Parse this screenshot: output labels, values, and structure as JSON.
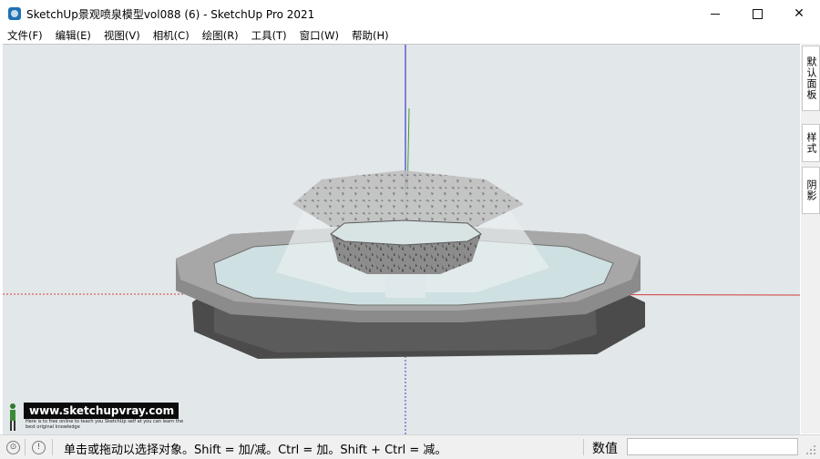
{
  "window": {
    "title": "SketchUp景观喷泉模型vol088 (6) - SketchUp Pro 2021",
    "minimize": "",
    "maximize": "",
    "close": "✕"
  },
  "menu": {
    "items": [
      "文件(F)",
      "编辑(E)",
      "视图(V)",
      "相机(C)",
      "绘图(R)",
      "工具(T)",
      "窗口(W)",
      "帮助(H)"
    ]
  },
  "tray": {
    "tabs": [
      "默认面板",
      "样式",
      "阴影"
    ]
  },
  "watermark": {
    "banner": "www.sketchupvray.com",
    "subtext": "Here is to free online to teach you SketchUp self at you can learn the best original knowledge"
  },
  "status": {
    "message": "单击或拖动以选择对象。Shift = 加/减。Ctrl = 加。Shift + Ctrl = 减。",
    "measurements_label": "数值",
    "measurements_value": ""
  },
  "colors": {
    "viewport_bg": "#e2e7e9",
    "axis_red": "#d23b3b",
    "axis_green": "#3aa23a",
    "axis_blue": "#3b3bd0"
  }
}
